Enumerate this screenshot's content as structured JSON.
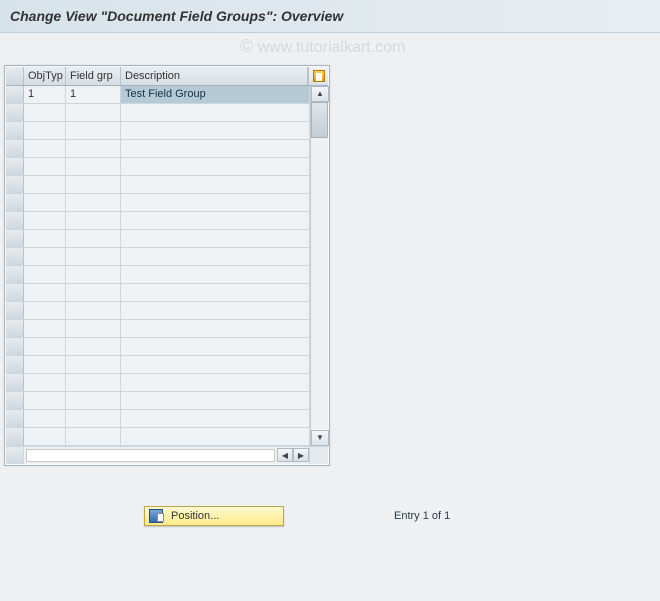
{
  "title": "Change View \"Document Field Groups\": Overview",
  "watermark": "www.tutorialkart.com",
  "table": {
    "columns": {
      "objtyp": "ObjTyp",
      "fieldgrp": "Field grp",
      "description": "Description"
    },
    "rows": [
      {
        "objtyp": "1",
        "fieldgrp": "1",
        "description": "Test Field Group",
        "selected": true
      }
    ],
    "empty_row_count": 19
  },
  "position_button": "Position...",
  "entry_status": "Entry 1 of 1",
  "icons": {
    "config": "table-settings-icon",
    "position": "position-cursor-icon"
  }
}
